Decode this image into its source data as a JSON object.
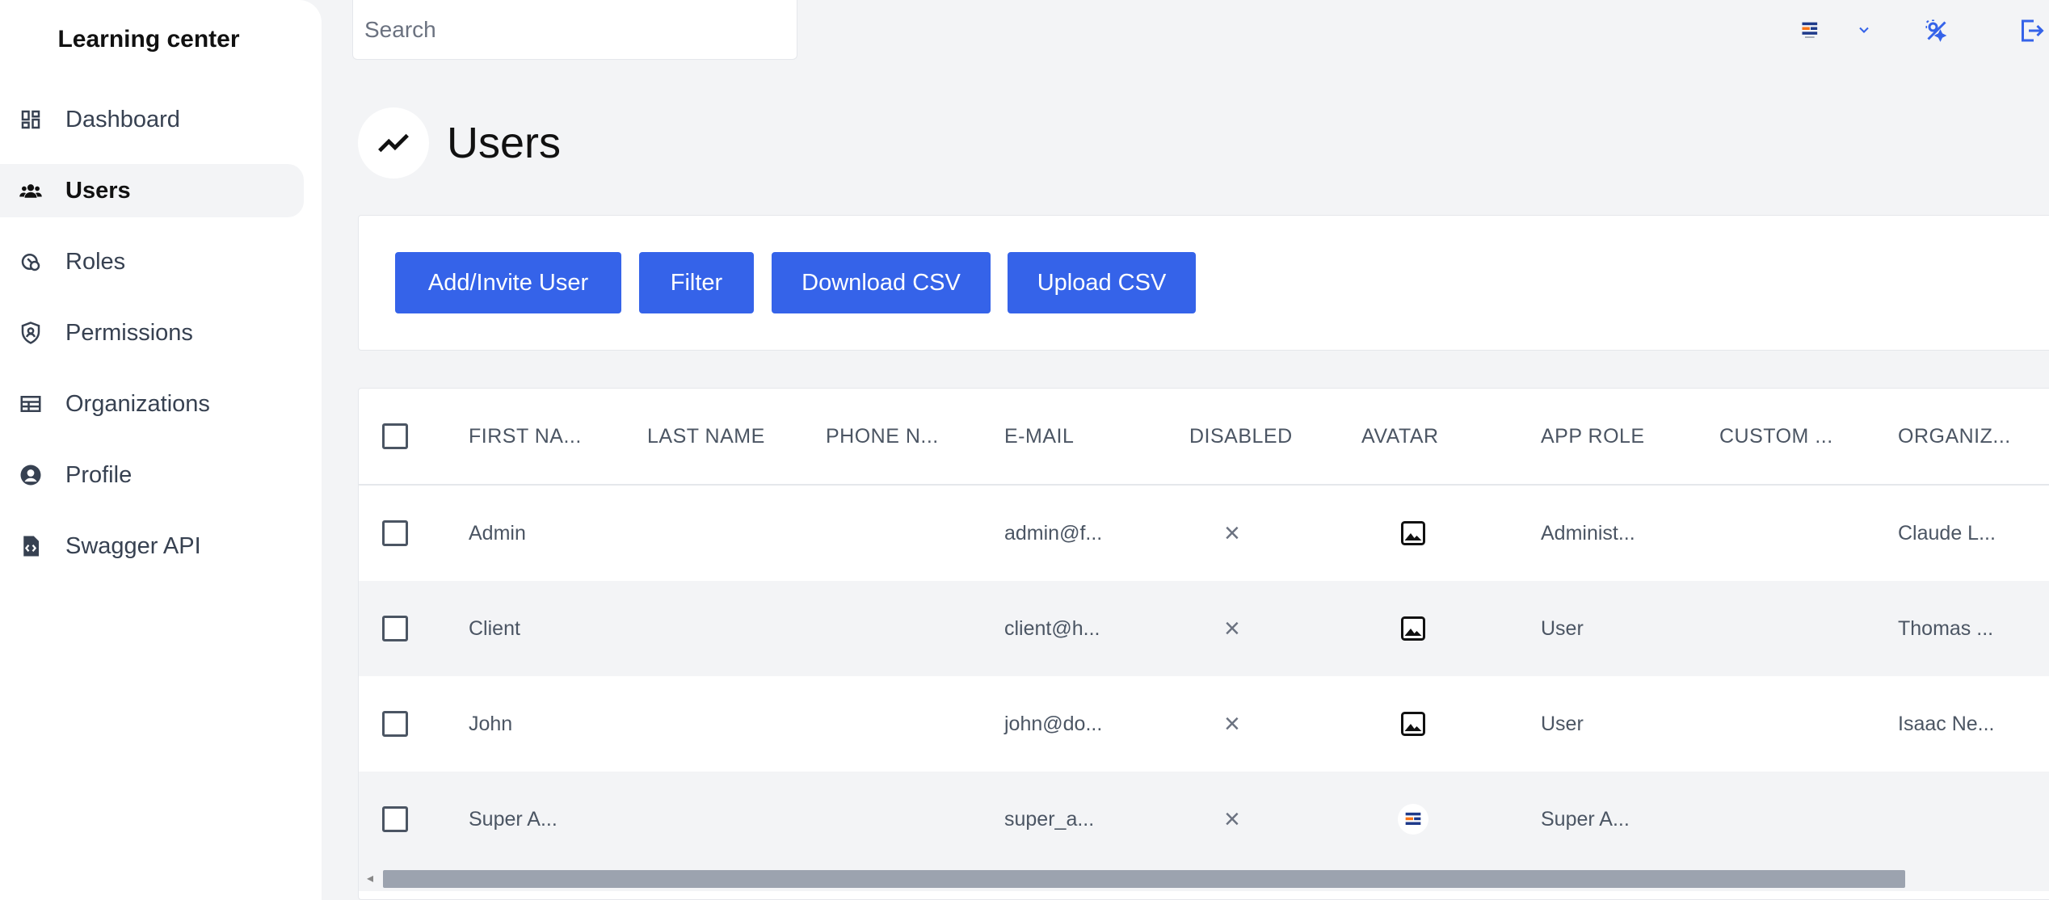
{
  "sidebar": {
    "brand": "Learning center",
    "items": [
      {
        "label": "Dashboard",
        "icon": "dashboard-icon"
      },
      {
        "label": "Users",
        "icon": "users-icon",
        "active": true
      },
      {
        "label": "Roles",
        "icon": "roles-icon"
      },
      {
        "label": "Permissions",
        "icon": "shield-icon"
      },
      {
        "label": "Organizations",
        "icon": "table-icon"
      },
      {
        "label": "Profile",
        "icon": "user-circle-icon"
      },
      {
        "label": "Swagger API",
        "icon": "file-code-icon"
      }
    ]
  },
  "topbar": {
    "search_placeholder": "Search",
    "icons": [
      "logo-icon",
      "chevron-down-icon",
      "theme-toggle-icon",
      "logout-icon"
    ]
  },
  "page": {
    "title": "Users",
    "title_icon": "trend-line-icon"
  },
  "actions": {
    "add_invite": "Add/Invite User",
    "filter": "Filter",
    "download_csv": "Download CSV",
    "upload_csv": "Upload CSV"
  },
  "table": {
    "columns": [
      "FIRST NA...",
      "LAST NAME",
      "PHONE N...",
      "E-MAIL",
      "DISABLED",
      "AVATAR",
      "APP ROLE",
      "CUSTOM ...",
      "ORGANIZ..."
    ],
    "rows": [
      {
        "first_name": "Admin",
        "last_name": "",
        "phone": "",
        "email": "admin@f...",
        "disabled": "×",
        "avatar": "image-icon",
        "app_role": "Administ...",
        "custom": "",
        "organization": "Claude L..."
      },
      {
        "first_name": "Client",
        "last_name": "",
        "phone": "",
        "email": "client@h...",
        "disabled": "×",
        "avatar": "image-icon",
        "app_role": "User",
        "custom": "",
        "organization": "Thomas ..."
      },
      {
        "first_name": "John",
        "last_name": "",
        "phone": "",
        "email": "john@do...",
        "disabled": "×",
        "avatar": "image-icon",
        "app_role": "User",
        "custom": "",
        "organization": "Isaac Ne..."
      },
      {
        "first_name": "Super A...",
        "last_name": "",
        "phone": "",
        "email": "super_a...",
        "disabled": "×",
        "avatar": "logo-icon",
        "app_role": "Super A...",
        "custom": "",
        "organization": ""
      }
    ]
  },
  "colors": {
    "primary_button": "#3563e9",
    "accent_icon": "#3563e9",
    "background": "#f3f4f6"
  }
}
